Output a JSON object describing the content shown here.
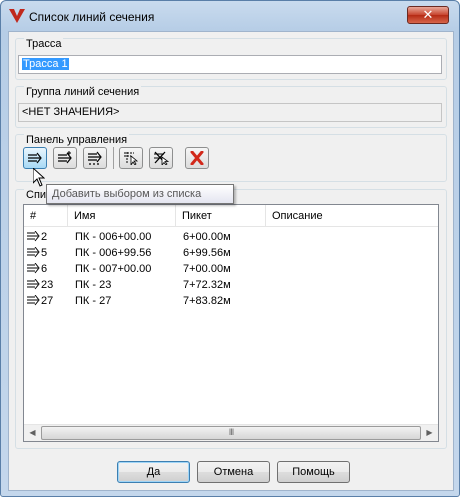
{
  "window": {
    "title": "Список линий сечения",
    "close_glyph": "✕"
  },
  "route": {
    "group_label": "Трасса",
    "value": "Трасса 1"
  },
  "sample_group": {
    "group_label": "Группа линий сечения",
    "value": "<НЕТ ЗНАЧЕНИЯ>"
  },
  "control_panel": {
    "group_label": "Панель управления",
    "buttons": [
      "add-from-list-icon",
      "add-icon",
      "add-range-icon",
      "select-pick-icon",
      "remove-pick-icon",
      "delete-icon"
    ]
  },
  "list_group": {
    "group_label_visible": "Спи"
  },
  "tooltip": {
    "text": "Добавить выбором из списка"
  },
  "table": {
    "columns": [
      "#",
      "Имя",
      "Пикет",
      "Описание"
    ],
    "rows": [
      {
        "num": "2",
        "name": "ПК - 006+00.00",
        "station": "6+00.00м",
        "desc": ""
      },
      {
        "num": "5",
        "name": "ПК - 006+99.56",
        "station": "6+99.56м",
        "desc": ""
      },
      {
        "num": "6",
        "name": "ПК - 007+00.00",
        "station": "7+00.00м",
        "desc": ""
      },
      {
        "num": "23",
        "name": "ПК - 23",
        "station": "7+72.32м",
        "desc": ""
      },
      {
        "num": "27",
        "name": "ПК - 27",
        "station": "7+83.82м",
        "desc": ""
      }
    ],
    "scroll_left": "◀",
    "scroll_right": "▶",
    "scroll_grip": "III"
  },
  "buttons": {
    "ok": "Да",
    "cancel": "Отмена",
    "help": "Помощь"
  },
  "colors": {
    "accent": "#3399ff",
    "delete_red": "#d2281a"
  }
}
